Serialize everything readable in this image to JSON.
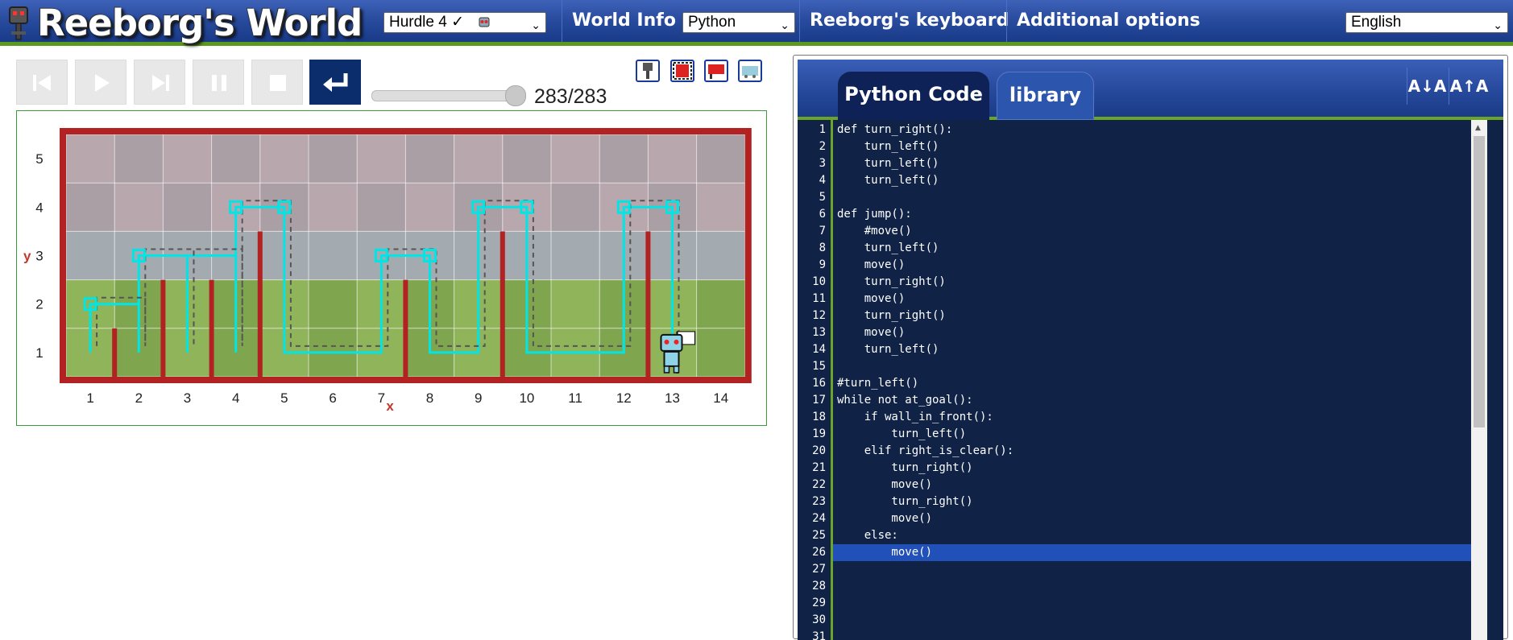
{
  "header": {
    "app_title": "Reeborg's World",
    "world_select": "Hurdle 4 ✓",
    "world_info": "World Info",
    "language_select": "Python",
    "keyboard": "Reeborg's keyboard",
    "additional_options": "Additional options",
    "ui_language": "English"
  },
  "controls": {
    "buttons": [
      "go-back",
      "run",
      "step",
      "pause",
      "stop",
      "reverse-step"
    ],
    "step_counter": "283/283",
    "step_progress": 1.0
  },
  "world": {
    "x_axis_label": "x",
    "y_axis_label": "y",
    "x_ticks": [
      "1",
      "2",
      "3",
      "4",
      "5",
      "6",
      "7",
      "8",
      "9",
      "10",
      "11",
      "12",
      "13",
      "14"
    ],
    "y_ticks": [
      "1",
      "2",
      "3",
      "4",
      "5"
    ],
    "robot_position": [
      13,
      1
    ],
    "goal_position": [
      13,
      1
    ],
    "colors": {
      "border": "#b22222",
      "trace": "#00e5e5",
      "wall": "#b22222"
    }
  },
  "editor": {
    "tabs": [
      "Python Code",
      "library"
    ],
    "font_decrease": "A↓A",
    "font_increase": "A↑A",
    "active_line": 26,
    "lines": [
      "def turn_right():",
      "    turn_left()",
      "    turn_left()",
      "    turn_left()",
      "",
      "def jump():",
      "    #move()",
      "    turn_left()",
      "    move()",
      "    turn_right()",
      "    move()",
      "    turn_right()",
      "    move()",
      "    turn_left()",
      "",
      "#turn_left()",
      "while not at_goal():",
      "    if wall_in_front():",
      "        turn_left()",
      "    elif right_is_clear():",
      "        turn_right()",
      "        move()",
      "        turn_right()",
      "        move()",
      "    else:",
      "        move()",
      "",
      "",
      "",
      "",
      ""
    ]
  }
}
